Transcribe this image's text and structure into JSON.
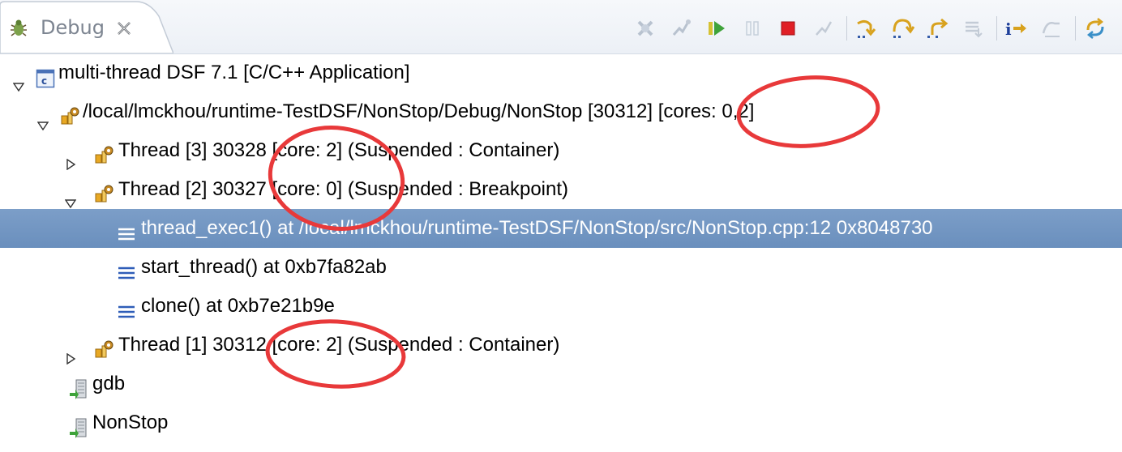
{
  "view": {
    "tab_title": "Debug",
    "tab_close_symbol": "✕",
    "toolbar_icons": [
      "remove-terminated-icon",
      "connect-icon",
      "resume-icon",
      "suspend-icon",
      "terminate-icon",
      "disconnect-icon",
      "step-into-icon",
      "step-over-icon",
      "step-return-icon",
      "drop-to-frame-icon",
      "instruction-stepping-mode-icon",
      "use-step-filters-icon",
      "view-menu-sync-icon"
    ]
  },
  "tree": {
    "launch": {
      "label": "multi-thread DSF 7.1 [C/C++ Application]"
    },
    "process": {
      "label": "/local/lmckhou/runtime-TestDSF/NonStop/Debug/NonStop [30312] [cores: 0,2]"
    },
    "threads": [
      {
        "label": "Thread [3] 30328 [core: 2] (Suspended : Container)",
        "expanded": false
      },
      {
        "label": "Thread [2] 30327 [core: 0] (Suspended : Breakpoint)",
        "expanded": true,
        "frames": [
          {
            "label": "thread_exec1() at /local/lmckhou/runtime-TestDSF/NonStop/src/NonStop.cpp:12 0x8048730",
            "selected": true
          },
          {
            "label": "start_thread() at 0xb7fa82ab",
            "selected": false
          },
          {
            "label": "clone() at 0xb7e21b9e",
            "selected": false
          }
        ]
      },
      {
        "label": "Thread [1] 30312 [core: 2] (Suspended : Container)",
        "expanded": false
      }
    ],
    "gdb": {
      "label": "gdb"
    },
    "app": {
      "label": "NonStop"
    }
  },
  "colors": {
    "selection": "#6f93c1",
    "annotation": "#e8393a",
    "frame_icon": "#2f5db8"
  }
}
